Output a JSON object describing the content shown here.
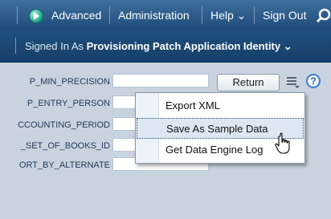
{
  "topbar": {
    "go_icon": "green-arrow-circle-icon",
    "links": [
      "Advanced",
      "Administration",
      "Help ⌄",
      "Sign Out"
    ],
    "search_icon": "search-icon"
  },
  "session": {
    "signed_in_label": "Signed In As",
    "user_name": "Provisioning Patch Application Identity ⌄"
  },
  "parameters": [
    {
      "label": "P_MIN_PRECISION",
      "value": ""
    },
    {
      "label": "P_ENTRY_PERSON",
      "value": ""
    },
    {
      "label": "CCOUNTING_PERIOD",
      "value": ""
    },
    {
      "label": "_SET_OF_BOOKS_ID",
      "value": ""
    },
    {
      "label": "ORT_BY_ALTERNATE",
      "value": ""
    }
  ],
  "toolbar": {
    "return_label": "Return",
    "actions_icon": "actions-menu-icon",
    "help_glyph": "?"
  },
  "actions_menu": {
    "items": [
      "Export XML",
      "Save As Sample Data",
      "Get Data Engine Log"
    ],
    "highlighted_index": 1
  },
  "colors": {
    "topbar": "#2d5e8e",
    "secondbar": "#1a4670",
    "content_bg": "#c9d3df",
    "menu_hover": "#dce7f3"
  }
}
